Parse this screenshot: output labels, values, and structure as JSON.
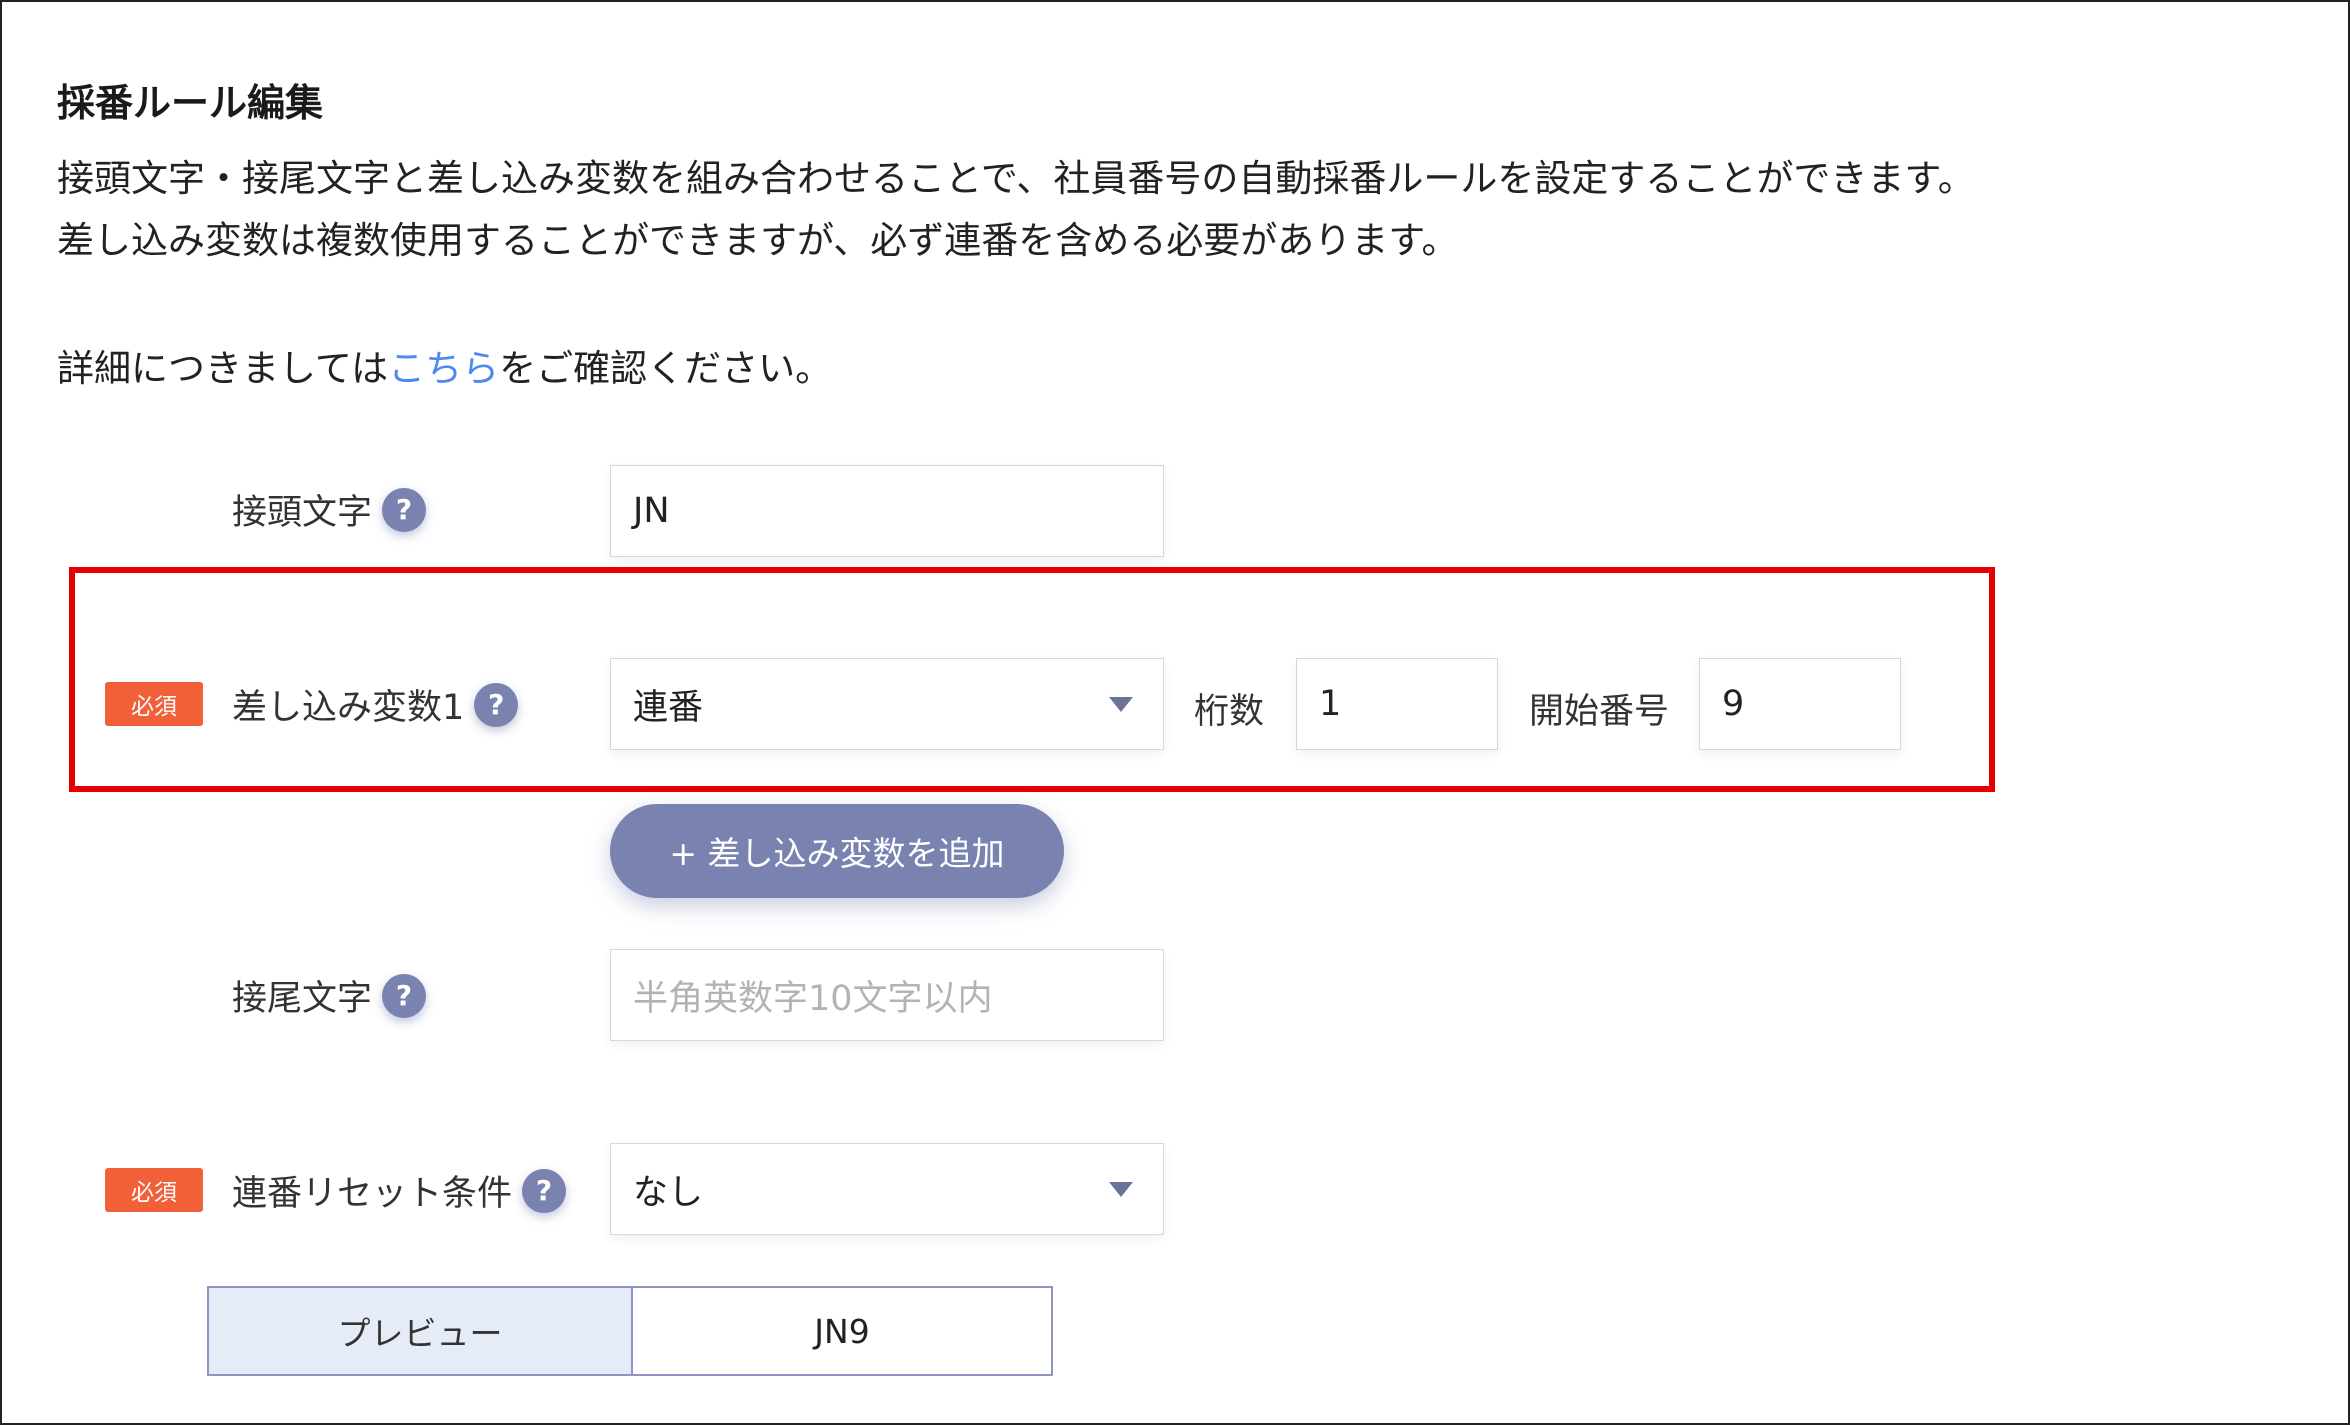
{
  "page": {
    "title": "採番ルール編集",
    "desc_line1": "接頭文字・接尾文字と差し込み変数を組み合わせることで、社員番号の自動採番ルールを設定することができます。",
    "desc_line2": "差し込み変数は複数使用することができますが、必ず連番を含める必要があります。",
    "detail_prefix": "詳細につきましては",
    "detail_link": "こちら",
    "detail_suffix": "をご確認ください。"
  },
  "icons": {
    "help": "?"
  },
  "form": {
    "required_badge": "必須",
    "prefix": {
      "label": "接頭文字",
      "value": "JN"
    },
    "variable1": {
      "label": "差し込み変数1",
      "selected": "連番",
      "digits_label": "桁数",
      "digits_value": "1",
      "start_label": "開始番号",
      "start_value": "9"
    },
    "add_variable_button": "+ 差し込み変数を追加",
    "suffix": {
      "label": "接尾文字",
      "placeholder": "半角英数字10文字以内",
      "value": ""
    },
    "reset_condition": {
      "label": "連番リセット条件",
      "selected": "なし"
    },
    "preview": {
      "label": "プレビュー",
      "value": "JN9"
    }
  },
  "colors": {
    "accent": "#7a82b0",
    "required": "#f2603a",
    "highlight_border": "#e60000",
    "link": "#4d8af0",
    "preview_bg": "#e6ecf7"
  }
}
